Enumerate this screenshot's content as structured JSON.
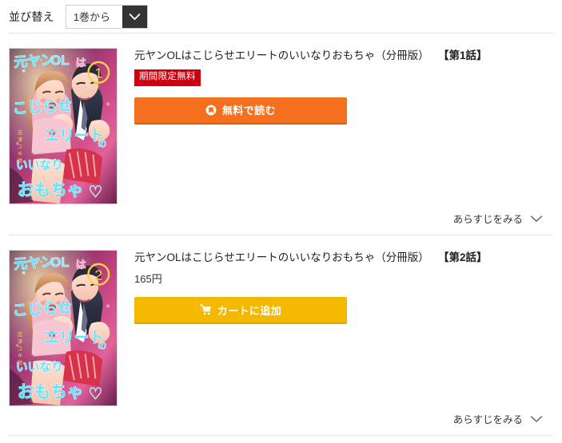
{
  "sort": {
    "label": "並び替え",
    "selected": "1巻から",
    "arrow_icon": "chevron-down-icon"
  },
  "colors": {
    "badge_red": "#cc0011",
    "free_button_orange": "#f4701f",
    "cart_button_yellow": "#f5b800",
    "select_arrow_dark": "#333333",
    "divider": "#e2e2e2"
  },
  "products": [
    {
      "title": "元ヤンOLはこじらせエリートのいいなりおもちゃ（分冊版）",
      "episode": "【第1話】",
      "badge": "期間限定無料",
      "price": "",
      "button_label": "無料で読む",
      "button_icon": "book-icon",
      "synopsis_label": "あらすじをみる",
      "synopsis_icon": "chevron-down-icon",
      "cover": {
        "volume_number": "1",
        "line1": "元ヤンOLは",
        "line2": "こじらせ",
        "line3": "エリートの",
        "line4": "いいなり",
        "line5": "おもちゃ",
        "author": "志津ユキ琉"
      }
    },
    {
      "title": "元ヤンOLはこじらせエリートのいいなりおもちゃ（分冊版）",
      "episode": "【第2話】",
      "badge": "",
      "price": "165円",
      "button_label": "カートに追加",
      "button_icon": "cart-icon",
      "synopsis_label": "あらすじをみる",
      "synopsis_icon": "chevron-down-icon",
      "cover": {
        "volume_number": "2",
        "line1": "元ヤンOLは",
        "line2": "こじらせ",
        "line3": "エリートの",
        "line4": "いいなり",
        "line5": "おもちゃ",
        "author": "志津ユキ琉"
      }
    }
  ]
}
